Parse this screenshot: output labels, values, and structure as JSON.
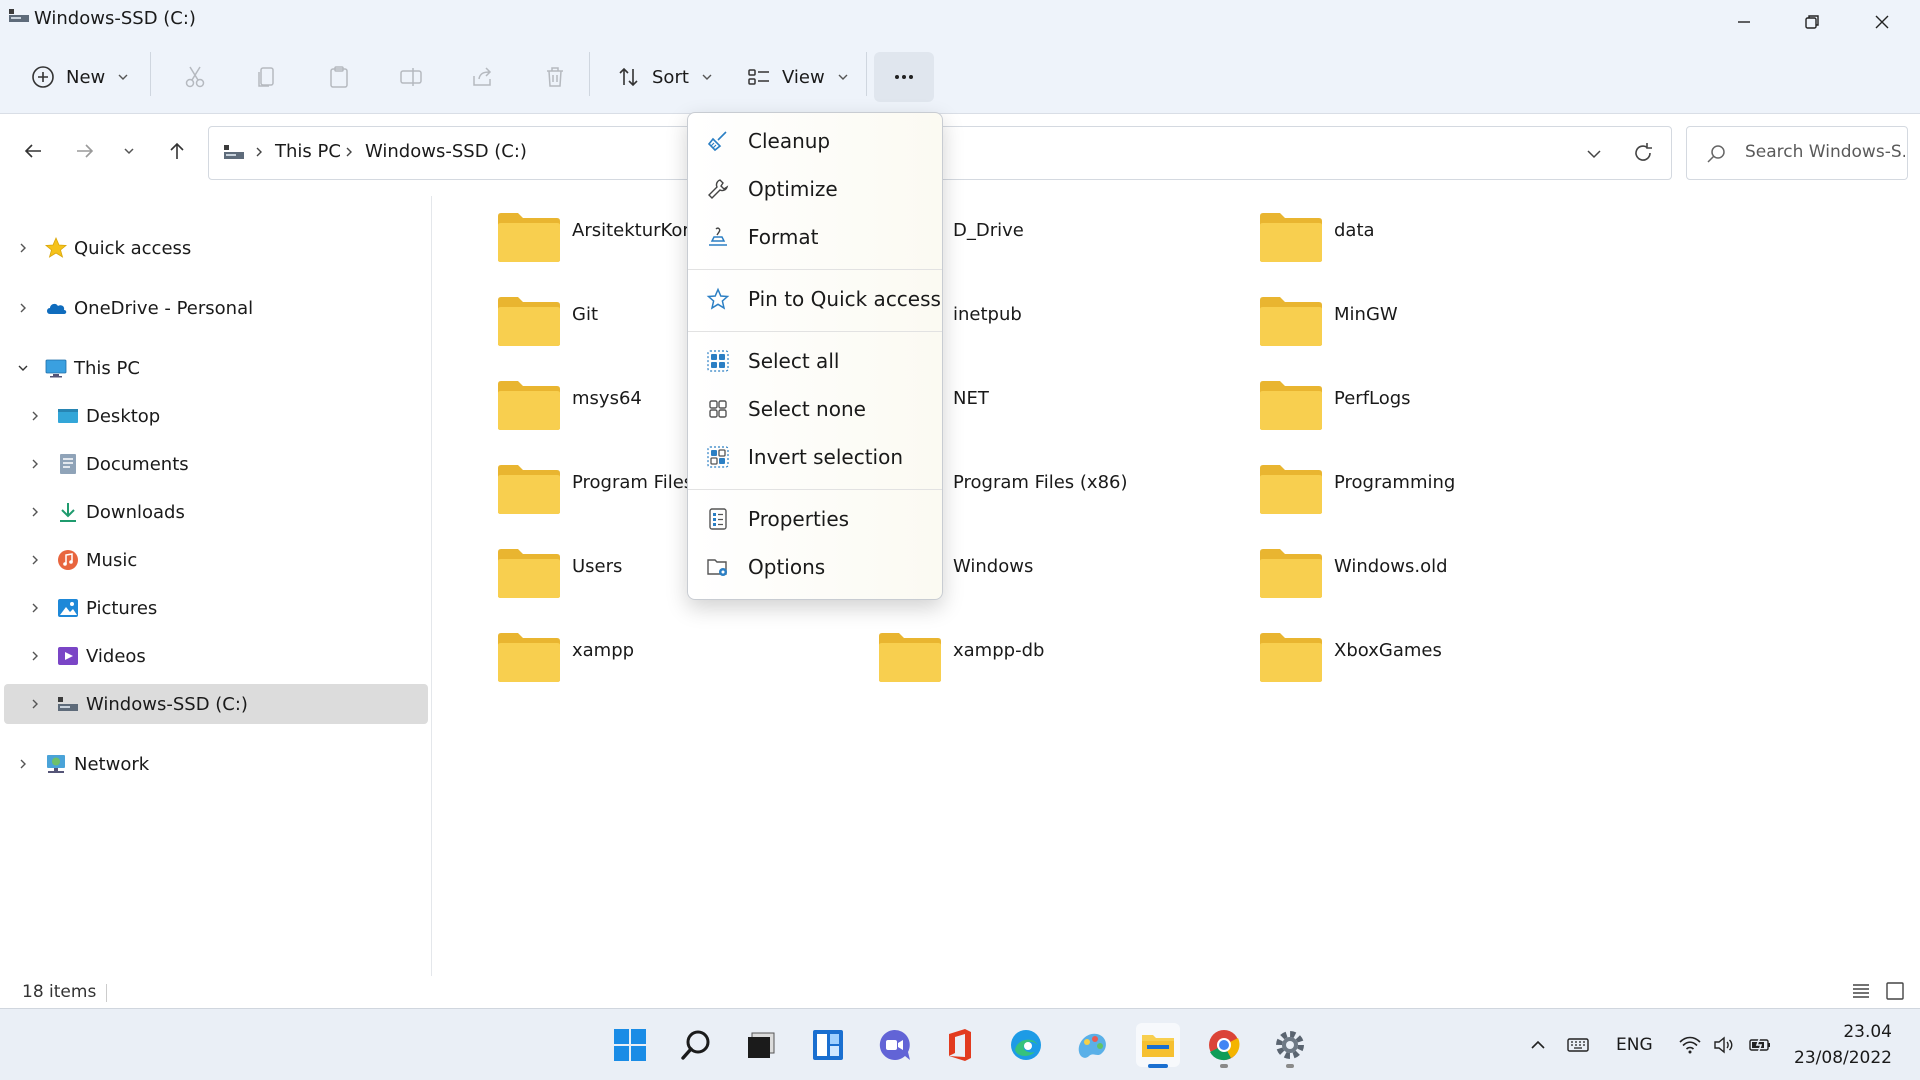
{
  "window": {
    "title": "Windows-SSD (C:)"
  },
  "toolbar": {
    "new_label": "New",
    "sort_label": "Sort",
    "view_label": "View"
  },
  "address": {
    "crumbs": [
      "This PC",
      "Windows-SSD (C:)"
    ],
    "search_placeholder": "Search Windows-S..."
  },
  "sidebar": {
    "items": [
      {
        "label": "Quick access",
        "icon": "star-icon"
      },
      {
        "label": "OneDrive - Personal",
        "icon": "cloud-icon"
      },
      {
        "label": "This PC",
        "icon": "computer-icon"
      },
      {
        "label": "Desktop",
        "icon": "desktop-icon"
      },
      {
        "label": "Documents",
        "icon": "documents-icon"
      },
      {
        "label": "Downloads",
        "icon": "download-icon"
      },
      {
        "label": "Music",
        "icon": "music-icon"
      },
      {
        "label": "Pictures",
        "icon": "pictures-icon"
      },
      {
        "label": "Videos",
        "icon": "videos-icon"
      },
      {
        "label": "Windows-SSD (C:)",
        "icon": "drive-icon"
      },
      {
        "label": "Network",
        "icon": "network-icon"
      }
    ]
  },
  "folders": [
    "ArsitekturKom",
    "D_Drive",
    "data",
    "Git",
    "inetpub",
    "MinGW",
    "msys64",
    "NET",
    "PerfLogs",
    "Program Files",
    "Program Files (x86)",
    "Programming",
    "Users",
    "Windows",
    "Windows.old",
    "xampp",
    "xampp-db",
    "XboxGames"
  ],
  "context_menu": {
    "items": [
      {
        "label": "Cleanup",
        "icon": "broom-icon"
      },
      {
        "label": "Optimize",
        "icon": "wrench-icon"
      },
      {
        "label": "Format",
        "icon": "format-icon"
      },
      {
        "label": "Pin to Quick access",
        "icon": "star-outline-icon"
      },
      {
        "label": "Select all",
        "icon": "select-all-icon"
      },
      {
        "label": "Select none",
        "icon": "select-none-icon"
      },
      {
        "label": "Invert selection",
        "icon": "invert-selection-icon"
      },
      {
        "label": "Properties",
        "icon": "properties-icon"
      },
      {
        "label": "Options",
        "icon": "options-icon"
      }
    ]
  },
  "status": {
    "item_count": "18 items"
  },
  "tray": {
    "language": "ENG",
    "time": "23.04",
    "date": "23/08/2022"
  },
  "colors": {
    "folder": "#f8cf4f",
    "accent": "#1a6fd0",
    "titlebar_bg": "#eef3fa",
    "selected_nav": "#dcdcdc"
  }
}
